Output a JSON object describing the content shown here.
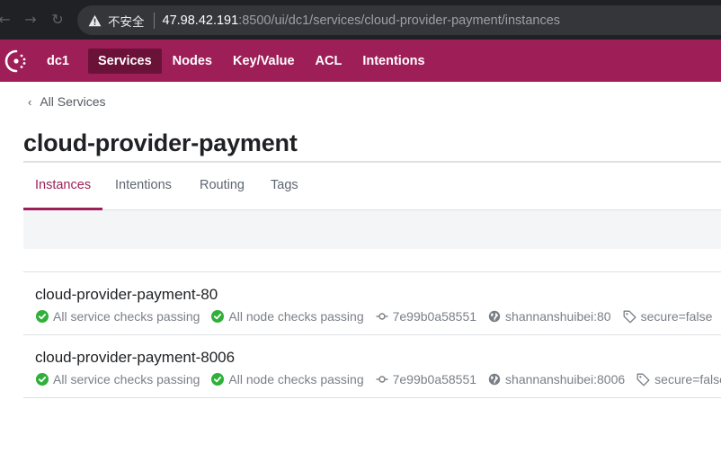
{
  "browser": {
    "insecure_label": "不安全",
    "url_host": "47.98.42.191",
    "url_rest": ":8500/ui/dc1/services/cloud-provider-payment/instances"
  },
  "nav": {
    "datacenter": "dc1",
    "items": [
      {
        "label": "Services",
        "active": true
      },
      {
        "label": "Nodes"
      },
      {
        "label": "Key/Value"
      },
      {
        "label": "ACL"
      },
      {
        "label": "Intentions"
      }
    ]
  },
  "breadcrumb": {
    "label": "All Services"
  },
  "page": {
    "title": "cloud-provider-payment"
  },
  "tabs": [
    {
      "label": "Instances",
      "active": true
    },
    {
      "label": "Intentions"
    },
    {
      "label": "Routing"
    },
    {
      "label": "Tags"
    }
  ],
  "instances": [
    {
      "name": "cloud-provider-payment-80",
      "service_checks": "All service checks passing",
      "node_checks": "All node checks passing",
      "commit": "7e99b0a58551",
      "address": "shannanshuibei:80",
      "tag": "secure=false"
    },
    {
      "name": "cloud-provider-payment-8006",
      "service_checks": "All service checks passing",
      "node_checks": "All node checks passing",
      "commit": "7e99b0a58551",
      "address": "shannanshuibei:8006",
      "tag": "secure=false"
    }
  ],
  "colors": {
    "brand": "#9e1f58",
    "brand_dark": "#6b1239",
    "passing": "#2eb039"
  },
  "icons": [
    "warning-icon",
    "consul-logo",
    "chevron-left-icon",
    "check-circle-icon",
    "commit-icon",
    "globe-icon",
    "tag-icon"
  ]
}
